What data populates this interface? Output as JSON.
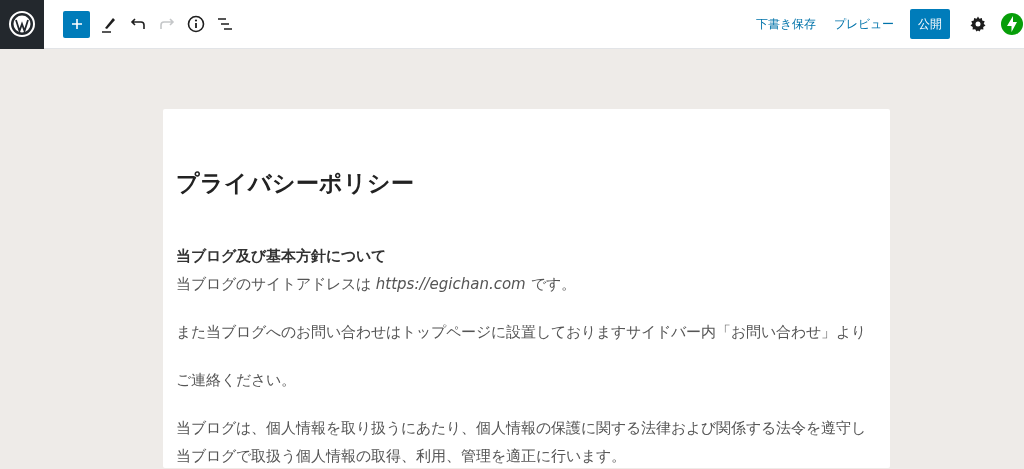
{
  "toolbar": {
    "tools": [
      {
        "kind": "add",
        "disabled": false
      },
      {
        "kind": "edit",
        "disabled": false
      },
      {
        "kind": "undo",
        "disabled": false
      },
      {
        "kind": "redo",
        "disabled": true
      },
      {
        "kind": "info",
        "disabled": false
      },
      {
        "kind": "outline",
        "disabled": false
      }
    ],
    "save_draft": "下書き保存",
    "preview": "プレビュー",
    "publish": "公開"
  },
  "document": {
    "title": "プライバシーポリシー",
    "blocks": [
      {
        "kind": "heading",
        "text": "当ブログ及び基本方針について"
      },
      {
        "kind": "line",
        "text": "当ブログのサイトアドレスは *https://egichan.com* です。"
      },
      {
        "kind": "gap"
      },
      {
        "kind": "line",
        "text": "また当ブログへのお問い合わせはトップページに設置しておりますサイドバー内「お問い合わせ」より"
      },
      {
        "kind": "gap"
      },
      {
        "kind": "line",
        "text": "ご連絡ください。"
      },
      {
        "kind": "gap"
      },
      {
        "kind": "line",
        "text": "当ブログは、個人情報を取り扱うにあたり、個人情報の保護に関する法律および関係する法令を遵守し"
      },
      {
        "kind": "line",
        "text": "当ブログで取扱う個人情報の取得、利用、管理を適正に行います。"
      }
    ]
  }
}
